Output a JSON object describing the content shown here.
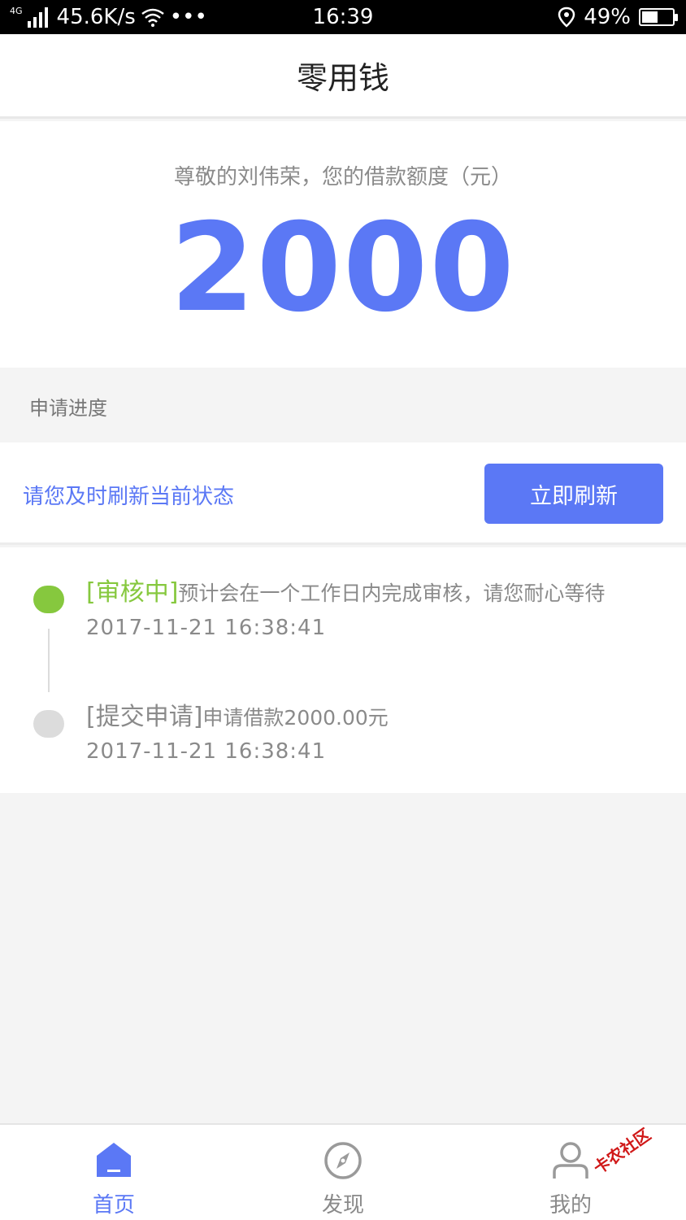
{
  "status_bar": {
    "network_type": "4G",
    "speed": "45.6K/s",
    "more": "•••",
    "time": "16:39",
    "battery": "49%"
  },
  "nav": {
    "title": "零用钱"
  },
  "quota": {
    "greeting": "尊敬的刘伟荣，您的借款额度（元）",
    "amount": "2000"
  },
  "progress": {
    "section_title": "申请进度",
    "refresh_hint": "请您及时刷新当前状态",
    "refresh_button": "立即刷新",
    "steps": [
      {
        "tag": "[审核中]",
        "message": "预计会在一个工作日内完成审核，请您耐心等待",
        "time": "2017-11-21 16:38:41",
        "status_color": "#86c83e"
      },
      {
        "tag": "[提交申请]",
        "message": "申请借款2000.00元",
        "time": "2017-11-21 16:38:41",
        "status_color": "#dcdcdc"
      }
    ]
  },
  "tabs": [
    {
      "label": "首页",
      "icon": "home-icon",
      "active": true
    },
    {
      "label": "发现",
      "icon": "compass-icon",
      "active": false
    },
    {
      "label": "我的",
      "icon": "user-icon",
      "active": false
    }
  ],
  "watermark": "卡农社区",
  "colors": {
    "accent": "#5b78f5",
    "success": "#86c83e",
    "muted": "#8a8a8a"
  }
}
